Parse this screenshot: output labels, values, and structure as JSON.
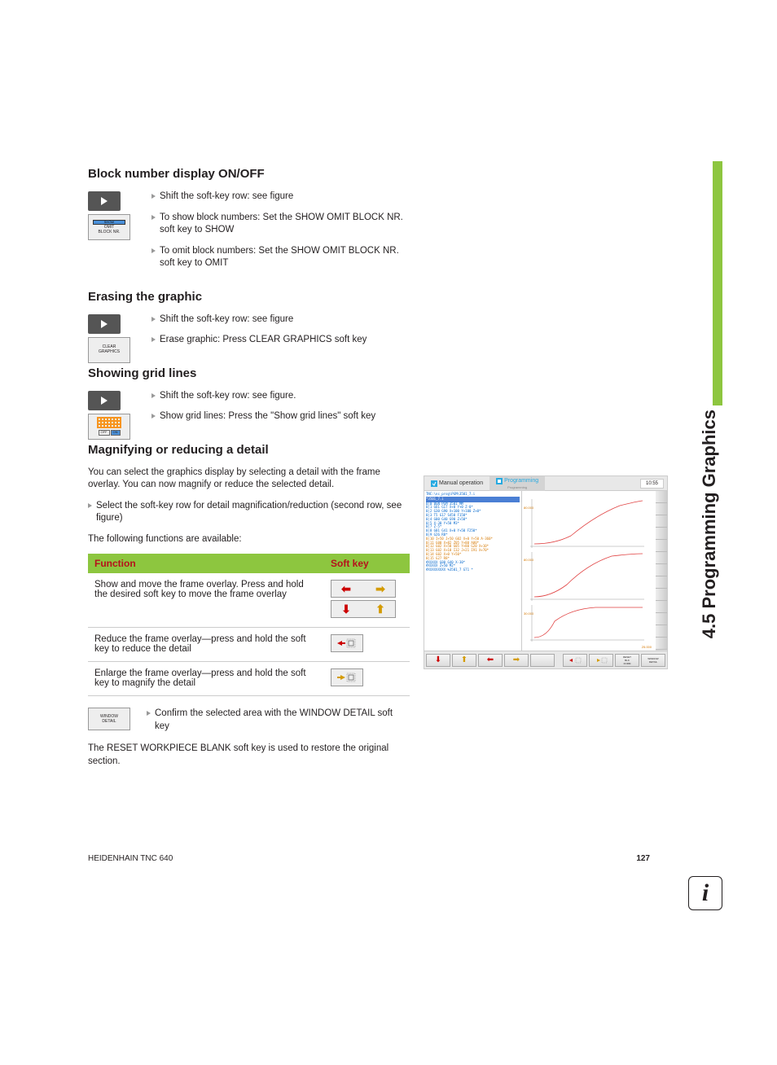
{
  "sideTab": "4.5 Programming Graphics",
  "sections": {
    "blockNumber": {
      "heading": "Block number display ON/OFF",
      "softkeyLabel": {
        "top": "SHOW",
        "mid": "OMIT",
        "bot": "BLOCK NR."
      },
      "bullets": [
        "Shift the soft-key row: see figure",
        "To show block numbers: Set the SHOW OMIT BLOCK NR. soft key to SHOW",
        "To omit block numbers: Set the SHOW OMIT BLOCK NR. soft key to OMIT"
      ]
    },
    "erasing": {
      "heading": "Erasing the graphic",
      "softkeyLabel": {
        "line1": "CLEAR",
        "line2": "GRAPHICS"
      },
      "bullets": [
        "Shift the soft-key row: see figure",
        "Erase graphic: Press CLEAR GRAPHICS soft key"
      ]
    },
    "gridLines": {
      "heading": "Showing grid lines",
      "softkeyLabel": {
        "off": "OFF",
        "on": "ON"
      },
      "bullets": [
        "Shift the soft-key row: see figure.",
        "Show grid lines: Press the \"Show grid lines\" soft key"
      ]
    },
    "magnify": {
      "heading": "Magnifying or reducing a detail",
      "para1": "You can select the graphics display by selecting a detail with the frame overlay. You can now magnify or reduce the selected detail.",
      "bullet1": "Select the soft-key row for detail magnification/reduction (second row, see figure)",
      "para2": "The following functions are available:",
      "tableHeader": {
        "func": "Function",
        "softkey": "Soft key"
      },
      "tableRows": [
        {
          "func": "Show and move the frame overlay. Press and hold the desired soft key to move the frame overlay"
        },
        {
          "func": "Reduce the frame overlay—press and hold the soft key to reduce the detail"
        },
        {
          "func": "Enlarge the frame overlay—press and hold the soft key to magnify the detail"
        }
      ],
      "confirmSoftkey": {
        "line1": "WINDOW",
        "line2": "DETAIL"
      },
      "confirmText": "Confirm the selected area with the WINDOW DETAIL soft key",
      "para3": "The RESET WORKPIECE BLANK soft key is used to restore the original section."
    }
  },
  "screenshot": {
    "tab1": "Manual operation",
    "tab2": "Programming",
    "tab2sub": "Programming",
    "time": "10:55",
    "codeHeader": "TNC:\\nc_prog\\PGM\\3501_7.i",
    "codeHighlight": "*3501_7.i",
    "codeLines": [
      "0|0 BGN PGM 3501 MM",
      "0|1 GO1 G17 X+0 Y+0 Z-0*",
      "0|2 G30 G90 X+100 Y+100 Z+0*",
      "0|3 T5 G17 S450 F150*",
      "0|4 G00 G40 G90 Z+50*",
      "0|5 X-30 Y+50 M3*",
      "0|7 Z-5*",
      "0|8 G01 G41 X+0 Y+50 F250*",
      "0|9 G26 R8*",
      "0|10 I+50 J+50 G02 X+0 Y+50 A-360*",
      "0|11 G00 X+82 Z05 Y+80 A80*",
      "0|12 G02 X+50 G05 Y+80 G20 X+10*",
      "0|13 G02 X+10 I32 J+21 I91 X+70*",
      "0|14 G02 X+0 Y+50*",
      "0|15 G27 R8*",
      "#XXXXX G00 G40 X-30*",
      "#XXXXX Z+50 M2*",
      "#XXXXXXXXX %3501_7 G71 *"
    ],
    "axisLabels": [
      "80.000",
      "80.000",
      "30.000",
      "25.000"
    ],
    "bottomButtons": {
      "resetFrame": "RESET\nBLK\nFORM",
      "windowDetail": "WINDOW\nDETAIL"
    }
  },
  "footer": {
    "left": "HEIDENHAIN TNC 640",
    "right": "127"
  }
}
